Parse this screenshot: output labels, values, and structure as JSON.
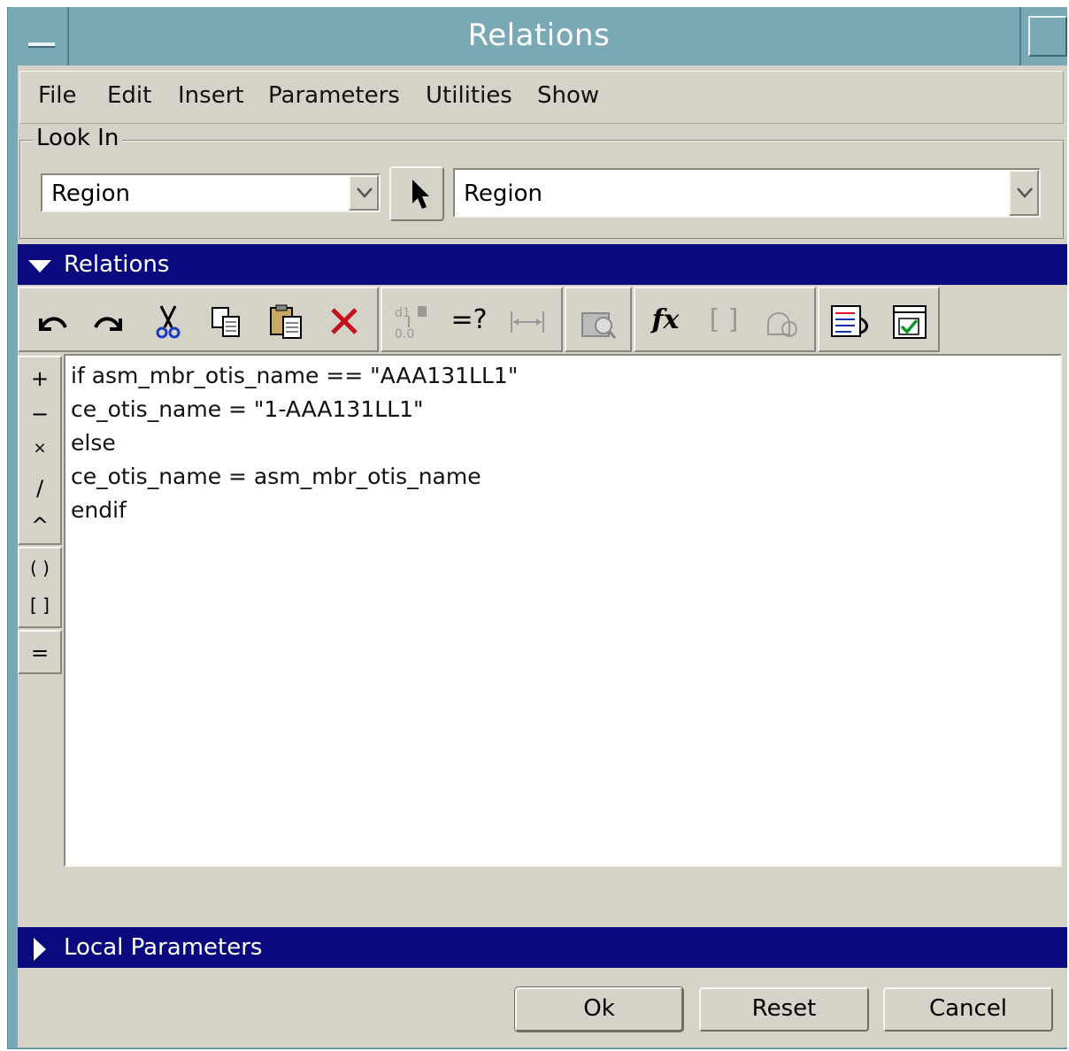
{
  "window": {
    "title": "Relations"
  },
  "menubar": {
    "items": [
      "File",
      "Edit",
      "Insert",
      "Parameters",
      "Utilities",
      "Show"
    ]
  },
  "look_in": {
    "legend": "Look In",
    "left_value": "Region",
    "right_value": "Region"
  },
  "relations_section": {
    "label": "Relations",
    "expanded": true
  },
  "toolbar": {
    "icons": [
      "undo-icon",
      "redo-icon",
      "cut-icon",
      "copy-icon",
      "paste-icon",
      "delete-icon",
      "sort-relations-icon",
      "evaluate-icon",
      "dimension-icon",
      "verify-icon",
      "function-icon",
      "brackets-icon",
      "parameter-icon",
      "show-dimensions-icon",
      "check-icon"
    ],
    "evaluate_label": "=?",
    "function_label": "fx",
    "brackets_label": "[ ]"
  },
  "operators": {
    "plus": "+",
    "minus": "−",
    "times": "×",
    "divide": "/",
    "power": "^",
    "parens": "( )",
    "brackets": "[ ]",
    "equals": "="
  },
  "editor": {
    "lines": [
      "if asm_mbr_otis_name == \"AAA131LL1\"",
      "ce_otis_name = \"1-AAA131LL1\"",
      "else",
      "ce_otis_name = asm_mbr_otis_name",
      "endif"
    ]
  },
  "local_parameters_section": {
    "label": "Local Parameters",
    "expanded": false
  },
  "buttons": {
    "ok": "Ok",
    "reset": "Reset",
    "cancel": "Cancel"
  },
  "colors": {
    "titlebar": "#7aa9b6",
    "section_bar": "#0a0a7e",
    "panel": "#d5d2c7"
  }
}
